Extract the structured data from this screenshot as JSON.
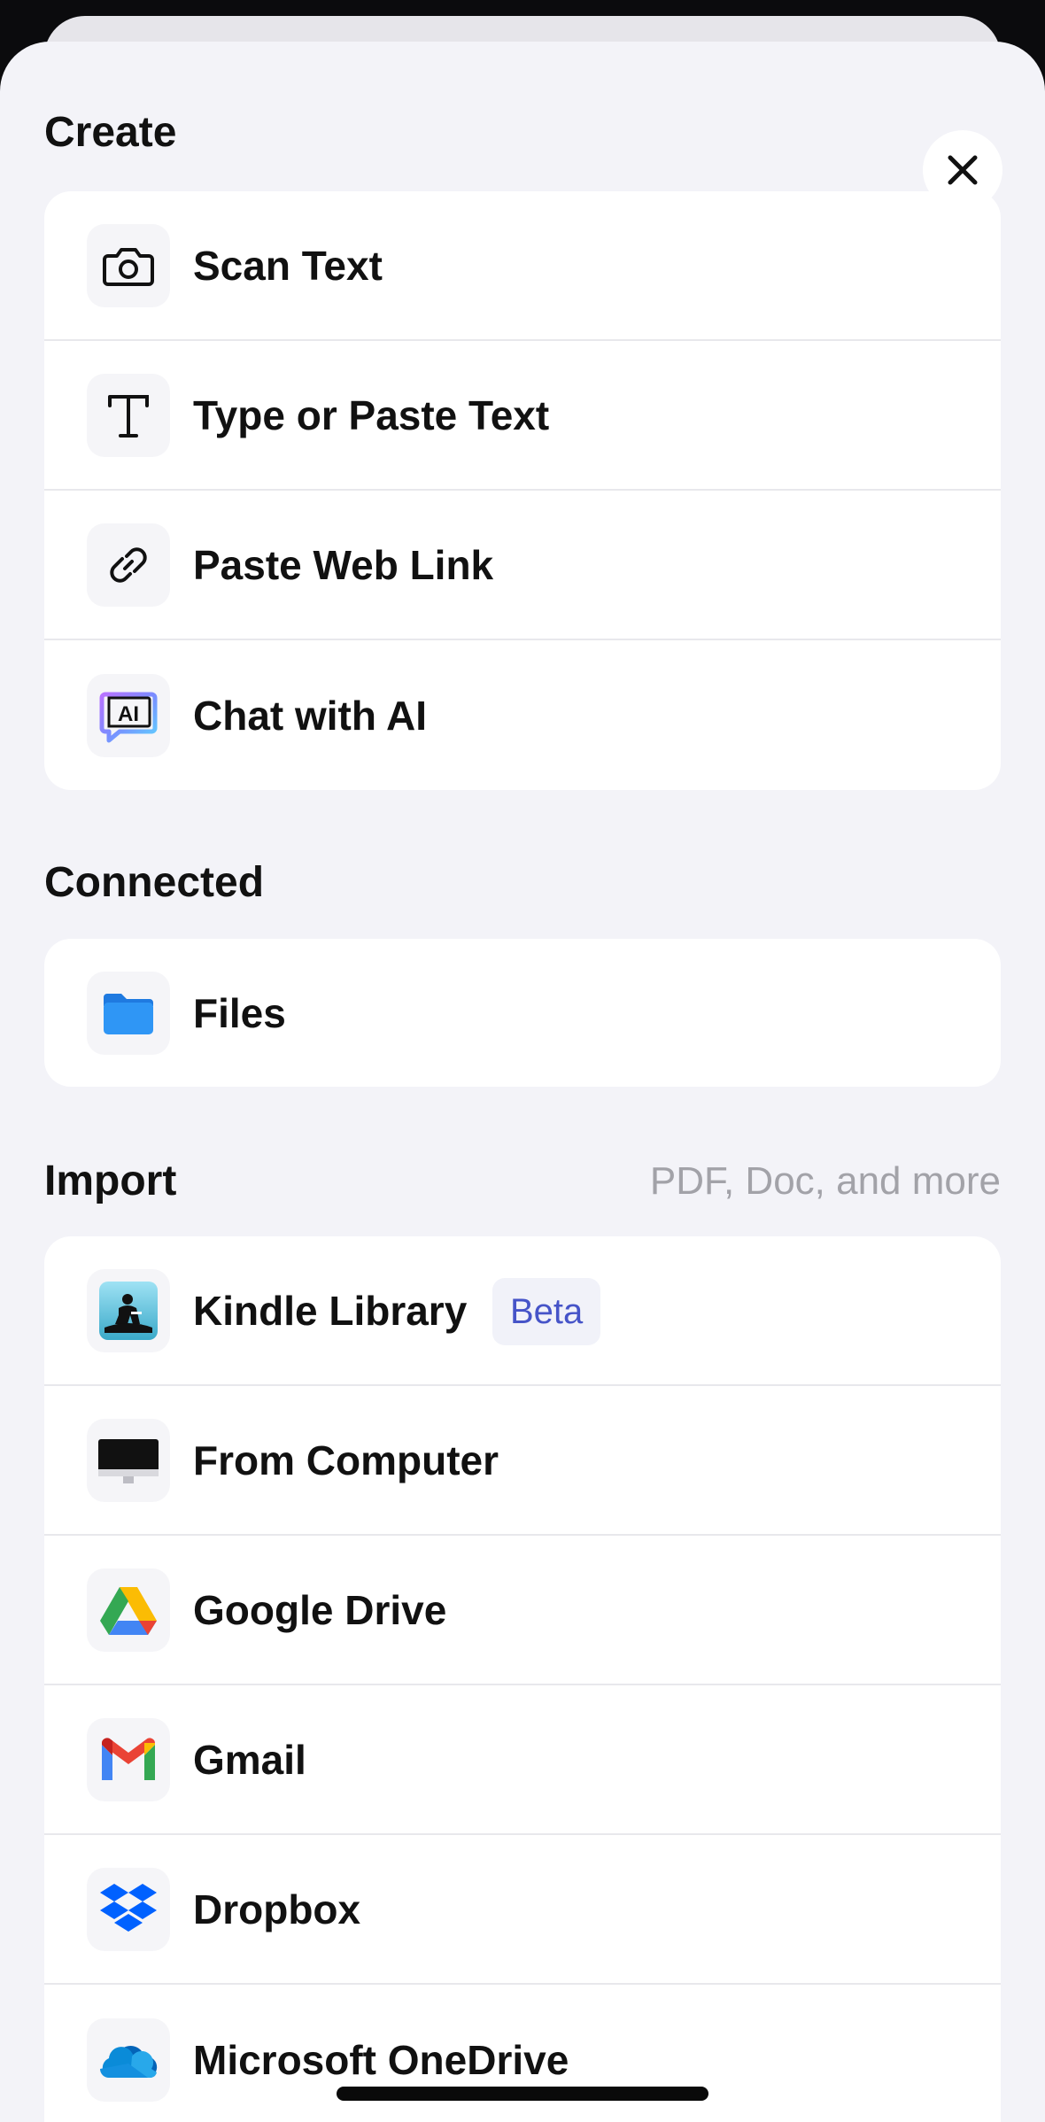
{
  "create": {
    "title": "Create",
    "items": [
      {
        "label": "Scan Text",
        "icon": "camera-icon"
      },
      {
        "label": "Type or Paste Text",
        "icon": "text-t-icon"
      },
      {
        "label": "Paste Web Link",
        "icon": "link-icon"
      },
      {
        "label": "Chat with AI",
        "icon": "ai-chat-icon"
      }
    ]
  },
  "connected": {
    "title": "Connected",
    "items": [
      {
        "label": "Files",
        "icon": "folder-icon"
      }
    ]
  },
  "import": {
    "title": "Import",
    "hint": "PDF, Doc, and more",
    "items": [
      {
        "label": "Kindle Library",
        "badge": "Beta",
        "icon": "kindle-icon"
      },
      {
        "label": "From Computer",
        "icon": "computer-icon"
      },
      {
        "label": "Google Drive",
        "icon": "google-drive-icon"
      },
      {
        "label": "Gmail",
        "icon": "gmail-icon"
      },
      {
        "label": "Dropbox",
        "icon": "dropbox-icon"
      },
      {
        "label": "Microsoft OneDrive",
        "icon": "onedrive-icon"
      }
    ]
  },
  "colors": {
    "sheet_background": "#f3f3f8",
    "card_background": "#ffffff",
    "badge_text": "#4654c8",
    "hint_text": "#a2a2a8"
  }
}
